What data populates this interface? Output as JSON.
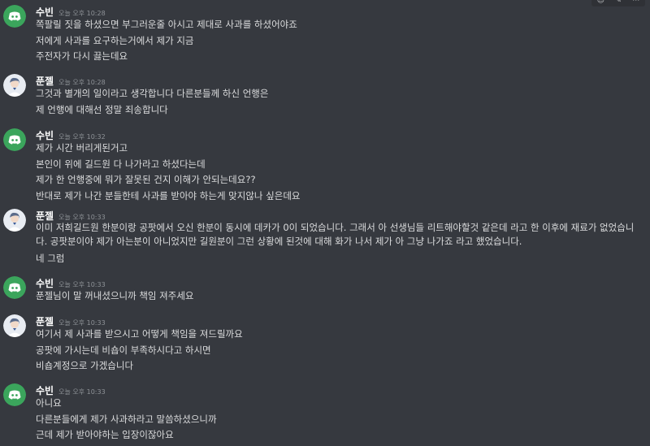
{
  "messages": [
    {
      "user": "수빈",
      "avatar": "discord-logo-icon",
      "time": "오늘 오후 10:28",
      "lines": [
        "쪽팔릴 짓을 하셨으면 부그러운줄 아시고 제대로 사과를 하셨어야죠",
        "저에게 사과를 요구하는거에서 제가 지금",
        "주전자가 다시 끓는데요"
      ]
    },
    {
      "user": "푼젤",
      "avatar": "user-portrait-icon",
      "time": "오늘 오후 10:28",
      "lines": [
        "그것과 별개의 일이라고 생각합니다 다른분들께 하신 언행은",
        "제 언행에 대해선 정말 죄송합니다"
      ]
    },
    {
      "user": "수빈",
      "avatar": "discord-logo-icon",
      "time": "오늘 오후 10:32",
      "lines": [
        "제가 시간 버리게된거고",
        "본인이 위에 길드원 다 나가라고 하셨다는데",
        "제가 한 언행중에 뭐가 잘못된 건지 이해가 안되는데요??",
        "반대로 제가 나간 분들한테 사과를 받아야 하는게 맞지않나 싶은데요"
      ]
    },
    {
      "user": "푼젤",
      "avatar": "user-portrait-icon",
      "time": "오늘 오후 10:33",
      "lines": [
        "이미 저희길드원 한분이랑 공팟에서 오신 한분이 동시에 데카가 0이 되었습니다. 그래서 아 선생님들 리트해야할것 같은데 라고 한 이후에 재료가 없었습니다. 공팟분이야 제가 아는분이 아니었지만 길원분이 그런 상황에 된것에 대해 화가 나서 제가 아 그냥 나가죠 라고 했었습니다.",
        "네 그럼"
      ]
    },
    {
      "user": "수빈",
      "avatar": "discord-logo-icon",
      "time": "오늘 오후 10:33",
      "lines": [
        "푼젤님이 말 꺼내셨으니까 책임 져주세요"
      ]
    },
    {
      "user": "푼젤",
      "avatar": "user-portrait-icon",
      "time": "오늘 오후 10:33",
      "lines": [
        "여기서 제 사과를 받으시고 어떻게 책임을 져드릴까요",
        "공팟에 가시는데 비숍이 부족하시다고 하시면",
        "비숍계정으로 가겠습니다"
      ]
    },
    {
      "user": "수빈",
      "avatar": "discord-logo-icon",
      "time": "오늘 오후 10:33",
      "lines": [
        "아니요",
        "다른분들에게 제가 사과하라고 말씀하셨으니까",
        "근데 제가 받아야하는 입장이잖아요"
      ]
    }
  ],
  "colors": {
    "background": "#36393f",
    "discord_avatar": "#3ba55c",
    "username": "#ffffff",
    "timestamp": "#8e9297",
    "text": "#dcddde"
  }
}
